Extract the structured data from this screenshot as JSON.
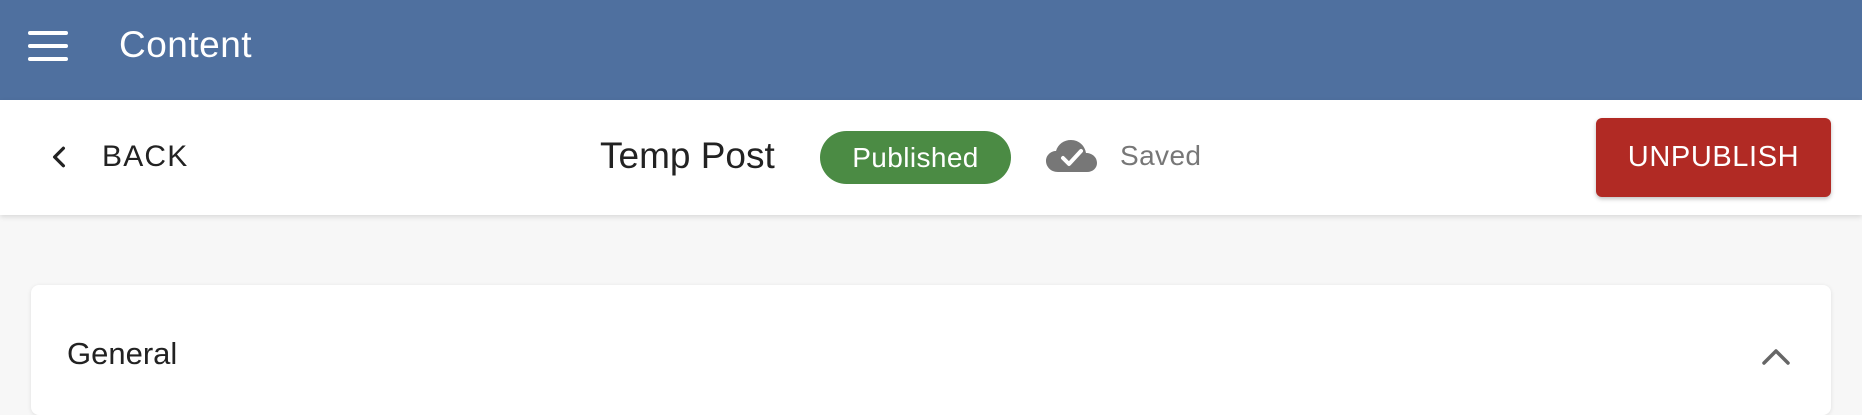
{
  "appbar": {
    "title": "Content",
    "menu_icon": "hamburger-menu-icon",
    "background": "#4f709f"
  },
  "toolbar": {
    "back_label": "BACK",
    "back_icon": "chevron-left-icon",
    "document_title": "Temp Post",
    "status_badge": "Published",
    "status_color": "#4b8b44",
    "save_status": "Saved",
    "save_icon": "cloud-check-icon",
    "unpublish_label": "UNPUBLISH",
    "unpublish_color": "#b12a24"
  },
  "main": {
    "section_title": "General",
    "section_toggle_icon": "chevron-up-icon"
  }
}
